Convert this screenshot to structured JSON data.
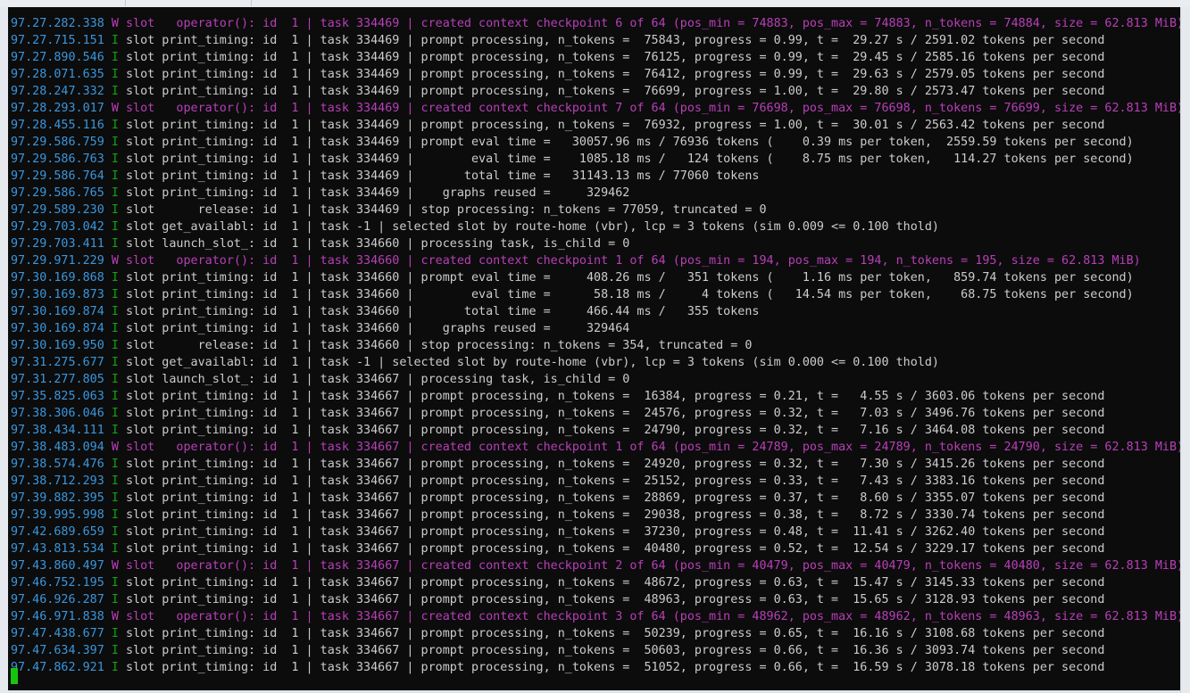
{
  "terminal": {
    "lines": [
      {
        "ts": "97.27.282.338",
        "lvl": "W",
        "text": " slot   operator(): id  1 | task 334469 | created context checkpoint 6 of 64 (pos_min = 74883, pos_max = 74883, n_tokens = 74884, size = 62.813 MiB)"
      },
      {
        "ts": "97.27.715.151",
        "lvl": "I",
        "text": " slot print_timing: id  1 | task 334469 | prompt processing, n_tokens =  75843, progress = 0.99, t =  29.27 s / 2591.02 tokens per second"
      },
      {
        "ts": "97.27.890.546",
        "lvl": "I",
        "text": " slot print_timing: id  1 | task 334469 | prompt processing, n_tokens =  76125, progress = 0.99, t =  29.45 s / 2585.16 tokens per second"
      },
      {
        "ts": "97.28.071.635",
        "lvl": "I",
        "text": " slot print_timing: id  1 | task 334469 | prompt processing, n_tokens =  76412, progress = 0.99, t =  29.63 s / 2579.05 tokens per second"
      },
      {
        "ts": "97.28.247.332",
        "lvl": "I",
        "text": " slot print_timing: id  1 | task 334469 | prompt processing, n_tokens =  76699, progress = 1.00, t =  29.80 s / 2573.47 tokens per second"
      },
      {
        "ts": "97.28.293.017",
        "lvl": "W",
        "text": " slot   operator(): id  1 | task 334469 | created context checkpoint 7 of 64 (pos_min = 76698, pos_max = 76698, n_tokens = 76699, size = 62.813 MiB)"
      },
      {
        "ts": "97.28.455.116",
        "lvl": "I",
        "text": " slot print_timing: id  1 | task 334469 | prompt processing, n_tokens =  76932, progress = 1.00, t =  30.01 s / 2563.42 tokens per second"
      },
      {
        "ts": "97.29.586.759",
        "lvl": "I",
        "text": " slot print_timing: id  1 | task 334469 | prompt eval time =   30057.96 ms / 76936 tokens (    0.39 ms per token,  2559.59 tokens per second)"
      },
      {
        "ts": "97.29.586.763",
        "lvl": "I",
        "text": " slot print_timing: id  1 | task 334469 |        eval time =    1085.18 ms /   124 tokens (    8.75 ms per token,   114.27 tokens per second)"
      },
      {
        "ts": "97.29.586.764",
        "lvl": "I",
        "text": " slot print_timing: id  1 | task 334469 |       total time =   31143.13 ms / 77060 tokens"
      },
      {
        "ts": "97.29.586.765",
        "lvl": "I",
        "text": " slot print_timing: id  1 | task 334469 |    graphs reused =     329462"
      },
      {
        "ts": "97.29.589.230",
        "lvl": "I",
        "text": " slot      release: id  1 | task 334469 | stop processing: n_tokens = 77059, truncated = 0"
      },
      {
        "ts": "97.29.703.042",
        "lvl": "I",
        "text": " slot get_availabl: id  1 | task -1 | selected slot by route-home (vbr), lcp = 3 tokens (sim 0.009 <= 0.100 thold)"
      },
      {
        "ts": "97.29.703.411",
        "lvl": "I",
        "text": " slot launch_slot_: id  1 | task 334660 | processing task, is_child = 0"
      },
      {
        "ts": "97.29.971.229",
        "lvl": "W",
        "text": " slot   operator(): id  1 | task 334660 | created context checkpoint 1 of 64 (pos_min = 194, pos_max = 194, n_tokens = 195, size = 62.813 MiB)"
      },
      {
        "ts": "97.30.169.868",
        "lvl": "I",
        "text": " slot print_timing: id  1 | task 334660 | prompt eval time =     408.26 ms /   351 tokens (    1.16 ms per token,   859.74 tokens per second)"
      },
      {
        "ts": "97.30.169.873",
        "lvl": "I",
        "text": " slot print_timing: id  1 | task 334660 |        eval time =      58.18 ms /     4 tokens (   14.54 ms per token,    68.75 tokens per second)"
      },
      {
        "ts": "97.30.169.874",
        "lvl": "I",
        "text": " slot print_timing: id  1 | task 334660 |       total time =     466.44 ms /   355 tokens"
      },
      {
        "ts": "97.30.169.874",
        "lvl": "I",
        "text": " slot print_timing: id  1 | task 334660 |    graphs reused =     329464"
      },
      {
        "ts": "97.30.169.950",
        "lvl": "I",
        "text": " slot      release: id  1 | task 334660 | stop processing: n_tokens = 354, truncated = 0"
      },
      {
        "ts": "97.31.275.677",
        "lvl": "I",
        "text": " slot get_availabl: id  1 | task -1 | selected slot by route-home (vbr), lcp = 3 tokens (sim 0.000 <= 0.100 thold)"
      },
      {
        "ts": "97.31.277.805",
        "lvl": "I",
        "text": " slot launch_slot_: id  1 | task 334667 | processing task, is_child = 0"
      },
      {
        "ts": "97.35.825.063",
        "lvl": "I",
        "text": " slot print_timing: id  1 | task 334667 | prompt processing, n_tokens =  16384, progress = 0.21, t =   4.55 s / 3603.06 tokens per second"
      },
      {
        "ts": "97.38.306.046",
        "lvl": "I",
        "text": " slot print_timing: id  1 | task 334667 | prompt processing, n_tokens =  24576, progress = 0.32, t =   7.03 s / 3496.76 tokens per second"
      },
      {
        "ts": "97.38.434.111",
        "lvl": "I",
        "text": " slot print_timing: id  1 | task 334667 | prompt processing, n_tokens =  24790, progress = 0.32, t =   7.16 s / 3464.08 tokens per second"
      },
      {
        "ts": "97.38.483.094",
        "lvl": "W",
        "text": " slot   operator(): id  1 | task 334667 | created context checkpoint 1 of 64 (pos_min = 24789, pos_max = 24789, n_tokens = 24790, size = 62.813 MiB)"
      },
      {
        "ts": "97.38.574.476",
        "lvl": "I",
        "text": " slot print_timing: id  1 | task 334667 | prompt processing, n_tokens =  24920, progress = 0.32, t =   7.30 s / 3415.26 tokens per second"
      },
      {
        "ts": "97.38.712.293",
        "lvl": "I",
        "text": " slot print_timing: id  1 | task 334667 | prompt processing, n_tokens =  25152, progress = 0.33, t =   7.43 s / 3383.16 tokens per second"
      },
      {
        "ts": "97.39.882.395",
        "lvl": "I",
        "text": " slot print_timing: id  1 | task 334667 | prompt processing, n_tokens =  28869, progress = 0.37, t =   8.60 s / 3355.07 tokens per second"
      },
      {
        "ts": "97.39.995.998",
        "lvl": "I",
        "text": " slot print_timing: id  1 | task 334667 | prompt processing, n_tokens =  29038, progress = 0.38, t =   8.72 s / 3330.74 tokens per second"
      },
      {
        "ts": "97.42.689.659",
        "lvl": "I",
        "text": " slot print_timing: id  1 | task 334667 | prompt processing, n_tokens =  37230, progress = 0.48, t =  11.41 s / 3262.40 tokens per second"
      },
      {
        "ts": "97.43.813.534",
        "lvl": "I",
        "text": " slot print_timing: id  1 | task 334667 | prompt processing, n_tokens =  40480, progress = 0.52, t =  12.54 s / 3229.17 tokens per second"
      },
      {
        "ts": "97.43.860.497",
        "lvl": "W",
        "text": " slot   operator(): id  1 | task 334667 | created context checkpoint 2 of 64 (pos_min = 40479, pos_max = 40479, n_tokens = 40480, size = 62.813 MiB)"
      },
      {
        "ts": "97.46.752.195",
        "lvl": "I",
        "text": " slot print_timing: id  1 | task 334667 | prompt processing, n_tokens =  48672, progress = 0.63, t =  15.47 s / 3145.33 tokens per second"
      },
      {
        "ts": "97.46.926.287",
        "lvl": "I",
        "text": " slot print_timing: id  1 | task 334667 | prompt processing, n_tokens =  48963, progress = 0.63, t =  15.65 s / 3128.93 tokens per second"
      },
      {
        "ts": "97.46.971.838",
        "lvl": "W",
        "text": " slot   operator(): id  1 | task 334667 | created context checkpoint 3 of 64 (pos_min = 48962, pos_max = 48962, n_tokens = 48963, size = 62.813 MiB)"
      },
      {
        "ts": "97.47.438.677",
        "lvl": "I",
        "text": " slot print_timing: id  1 | task 334667 | prompt processing, n_tokens =  50239, progress = 0.65, t =  16.16 s / 3108.68 tokens per second"
      },
      {
        "ts": "97.47.634.397",
        "lvl": "I",
        "text": " slot print_timing: id  1 | task 334667 | prompt processing, n_tokens =  50603, progress = 0.66, t =  16.36 s / 3093.74 tokens per second"
      },
      {
        "ts": "97.47.862.921",
        "lvl": "I",
        "text": " slot print_timing: id  1 | task 334667 | prompt processing, n_tokens =  51052, progress = 0.66, t =  16.59 s / 3078.18 tokens per second"
      }
    ]
  },
  "colors": {
    "background": "#0c0c0c",
    "timestamp": "#3a96dd",
    "info_level": "#13a10e",
    "warn_level": "#b83fb8",
    "text": "#cccccc",
    "cursor": "#16c60c"
  }
}
